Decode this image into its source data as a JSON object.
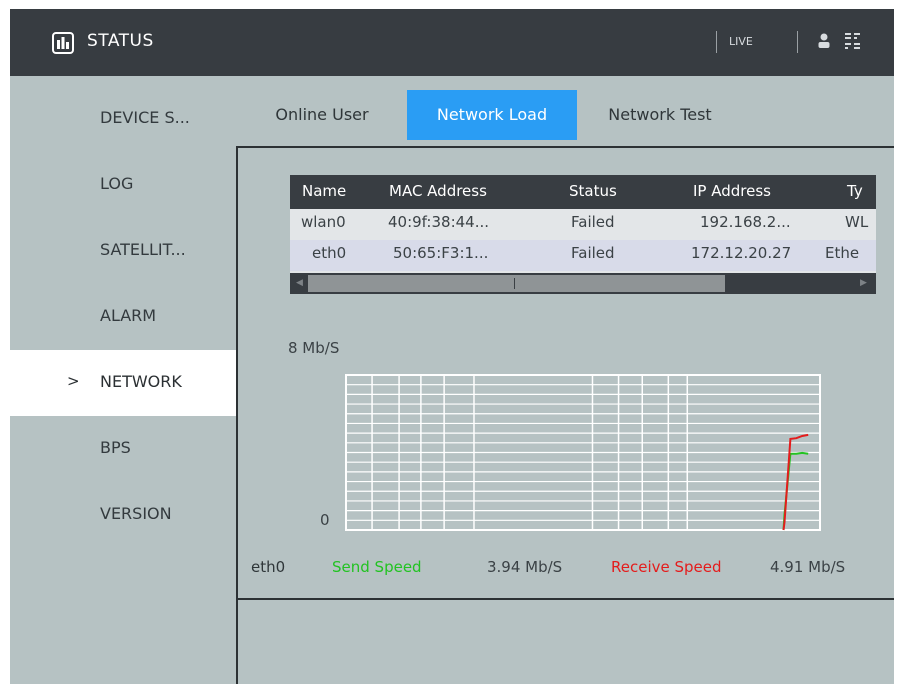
{
  "header": {
    "title": "STATUS",
    "live_label": "LIVE",
    "icons": [
      "status-logo-icon",
      "user-icon",
      "layout-icon"
    ]
  },
  "sidebar": {
    "items": [
      {
        "label": "DEVICE S...",
        "active": false
      },
      {
        "label": "LOG",
        "active": false
      },
      {
        "label": "SATELLIT...",
        "active": false
      },
      {
        "label": "ALARM",
        "active": false
      },
      {
        "label": "NETWORK",
        "active": true
      },
      {
        "label": "BPS",
        "active": false
      },
      {
        "label": "VERSION",
        "active": false
      }
    ],
    "active_marker": ">"
  },
  "tabs": [
    {
      "label": "Online User",
      "active": false
    },
    {
      "label": "Network Load",
      "active": true
    },
    {
      "label": "Network Test",
      "active": false
    }
  ],
  "table": {
    "columns": [
      "Name",
      "MAC Address",
      "Status",
      "IP Address",
      "Ty"
    ],
    "rows": [
      [
        "wlan0",
        "40:9f:38:44...",
        "Failed",
        "192.168.2...",
        "WL"
      ],
      [
        "eth0",
        "50:65:F3:1...",
        "Failed",
        "172.12.20.27",
        "Ethe"
      ]
    ],
    "selected_row": 1
  },
  "chart_data": {
    "type": "line",
    "y_max_label": "8 Mb/S",
    "y_min_label": "0",
    "ylim": [
      0,
      8
    ],
    "unit": "Mb/S",
    "grid": true,
    "series": [
      {
        "name": "Send Speed",
        "color": "#22c322",
        "values": [
          0,
          0,
          0,
          0,
          0,
          0,
          0,
          0,
          0,
          0,
          0,
          0,
          0,
          0,
          0,
          0,
          0,
          0,
          0.8,
          3.94,
          3.94,
          3.98,
          3.94
        ]
      },
      {
        "name": "Receive Speed",
        "color": "#e41c1c",
        "values": [
          0,
          0,
          0,
          0,
          0,
          0,
          0,
          0,
          0,
          0,
          0,
          0,
          0,
          0,
          0,
          0,
          0,
          0,
          0.4,
          4.7,
          4.74,
          4.85,
          4.91
        ]
      }
    ]
  },
  "legend": {
    "interface": "eth0",
    "send_label": "Send Speed",
    "send_value": "3.94 Mb/S",
    "receive_label": "Receive Speed",
    "receive_value": "4.91 Mb/S",
    "send_color": "#22c322",
    "receive_color": "#e41c1c"
  },
  "colors": {
    "accent": "#2a9df4",
    "topbar": "#373c41",
    "background": "#b6c2c3"
  }
}
